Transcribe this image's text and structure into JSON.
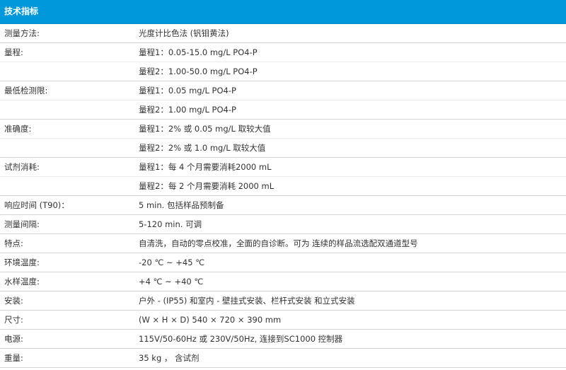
{
  "header": {
    "title": "技术指标"
  },
  "rows": [
    {
      "label": "测量方法:",
      "value": "光度计比色法 (钒钼黄法)"
    },
    {
      "label": "量程:",
      "value": "量程1：0.05-15.0 mg/L PO4-P"
    },
    {
      "label": "",
      "value": "量程2：1.00-50.0 mg/L PO4-P"
    },
    {
      "label": "最低检测限:",
      "value": "量程1：0.05 mg/L PO4-P"
    },
    {
      "label": "",
      "value": "量程2：1.00 mg/L PO4-P"
    },
    {
      "label": "准确度:",
      "value": "量程1：2% 或 0.05 mg/L 取较大值"
    },
    {
      "label": "",
      "value": "量程2：2% 或 1.0 mg/L 取较大值"
    },
    {
      "label": "试剂消耗:",
      "value": "量程1：每 4 个月需要消耗2000 mL"
    },
    {
      "label": "",
      "value": "量程2：每 2 个月需要消耗 2000 mL"
    },
    {
      "label": "响应时间 (T90)：",
      "value": "5 min. 包括样品预制备"
    },
    {
      "label": "测量间隔:",
      "value": "5-120 min. 可调"
    },
    {
      "label": "特点:",
      "value": "自清洗，自动的零点校准，全面的自诊断。可为 连续的样品流选配双通道型号"
    },
    {
      "label": "环境温度:",
      "value": "-20 ℃ ~ +45 ℃"
    },
    {
      "label": "水样温度:",
      "value": "+4 ℃ ~ +40 ℃"
    },
    {
      "label": "安装:",
      "value": "户外 - (IP55) 和室内 - 壁挂式安装、栏杆式安装 和立式安装"
    },
    {
      "label": "尺寸:",
      "value": "(W × H × D) 540 × 720 × 390 mm"
    },
    {
      "label": "电源:",
      "value": "115V/50-60Hz 或 230V/50Hz, 连接到SC1000 控制器"
    },
    {
      "label": "重量:",
      "value": "35 kg ， 含试剂"
    }
  ]
}
